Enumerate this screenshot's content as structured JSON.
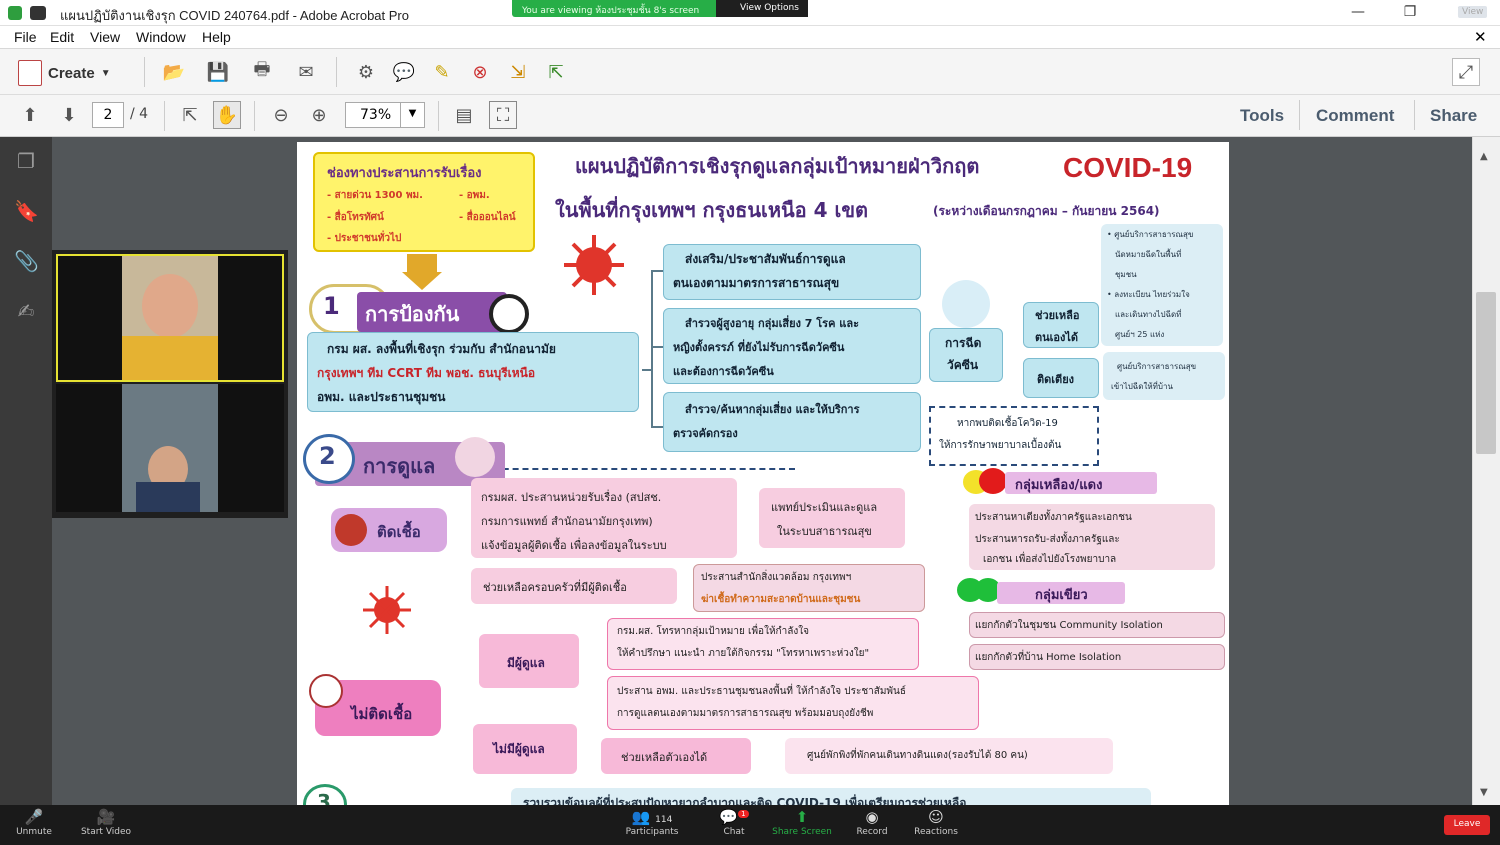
{
  "window": {
    "title": "แผนปฏิบัติงานเชิงรุก COVID 240764.pdf - Adobe Acrobat Pro",
    "view_label": "View"
  },
  "zoom_banner": {
    "text": "You are viewing ห้องประชุมชั้น 8's screen",
    "view_options": "View Options"
  },
  "menu": [
    "File",
    "Edit",
    "View",
    "Window",
    "Help"
  ],
  "toolbar": {
    "create": "Create",
    "page_current": "2",
    "page_total": "/ 4",
    "zoom": "73%",
    "tabs": [
      "Tools",
      "Comment",
      "Share"
    ]
  },
  "doc": {
    "contact_title": "ช่องทางประสานการรับเรื่อง",
    "contact_items": [
      "- สายด่วน 1300 พม.",
      "- อพม.",
      "- สื่อโทรทัศน์",
      "- สื่อออนไลน์",
      "- ประชาชนทั่วไป"
    ],
    "title1": "แผนปฏิบัติการเชิงรุกดูแลกลุ่มเป้าหมายฝ่าวิกฤต",
    "title2": "ในพื้นที่กรุงเทพฯ กรุงธนเหนือ 4 เขต",
    "title2_paren": "(ระหว่างเดือนกรกฎาคม – กันยายน 2564)",
    "logo_text": "COVID-19",
    "s1_num": "1",
    "s1_label": "การป้องกัน",
    "s1_desc": [
      "กรม ผส. ลงพื้นที่เชิงรุก ร่วมกับ สำนักอนามัย",
      "กรุงเทพฯ ทีม CCRT ทีม พอช. ธนบุรีเหนือ",
      "อพม. และประธานชุมชน"
    ],
    "p1": [
      "ส่งเสริม/ประชาสัมพันธ์การดูแล",
      "ตนเองตามมาตรการสาธารณสุข"
    ],
    "p2": [
      "สำรวจผู้สูงอายุ กลุ่มเสี่ยง 7 โรค และ",
      "หญิงตั้งครรภ์ ที่ยังไม่รับการฉีดวัคซีน",
      "และต้องการฉีดวัคซีน"
    ],
    "p3": [
      "สำรวจ/ค้นหากลุ่มเสี่ยง และให้บริการ",
      "ตรวจคัดกรอง"
    ],
    "vaccine": [
      "การฉีด",
      "วัคซีน"
    ],
    "self_help": [
      "ช่วยเหลือ",
      "ตนเองได้"
    ],
    "bedridden": "ติดเตียง",
    "note1": [
      "• ศูนย์บริการสาธารณสุข",
      "นัดหมายฉีดในพื้นที่",
      "ชุมชน",
      "• ลงทะเบียน ไทยร่วมใจ",
      "และเดินทางไปฉีดที่",
      "ศูนย์ฯ 25 แห่ง"
    ],
    "note2": [
      "ศูนย์บริการสาธารณสุข",
      "เข้าไปฉีดให้ที่บ้าน"
    ],
    "if_found": [
      "หากพบติดเชื้อโควิด-19",
      "ให้การรักษาพยาบาลเบื้องต้น"
    ],
    "s2_num": "2",
    "s2_label": "การดูแล",
    "infected": "ติดเชื้อ",
    "c1": [
      "กรมผส. ประสานหน่วยรับเรื่อง (สปสช.",
      "กรมการแพทย์ สำนักอนามัยกรุงเทพ)",
      "แจ้งข้อมูลผู้ติดเชื้อ เพื่อลงข้อมูลในระบบ"
    ],
    "c2": [
      "แพทย์ประเมินและดูแล",
      "ในระบบสาธารณสุข"
    ],
    "c3": "ช่วยเหลือครอบครัวที่มีผู้ติดเชื้อ",
    "c4": [
      "ประสานสำนักสิ่งแวดล้อม กรุงเทพฯ",
      "ฆ่าเชื้อทำความสะอาดบ้านและชุมชน"
    ],
    "yellow_red": "กลุ่มเหลือง/แดง",
    "yr1": "ประสานหาเตียงทั้งภาครัฐและเอกชน",
    "yr2": [
      "ประสานหารถรับ-ส่งทั้งภาครัฐและ",
      "เอกชน เพื่อส่งไปยังโรงพยาบาล"
    ],
    "green": "กลุ่มเขียว",
    "g1": "แยกกักตัวในชุมชน Community Isolation",
    "g2": "แยกกักตัวที่บ้าน Home Isolation",
    "not_infected": "ไม่ติดเชื้อ",
    "has_caregiver": "มีผู้ดูแล",
    "no_caregiver": "ไม่มีผู้ดูแล",
    "n1": [
      "กรม.ผส. โทรหากลุ่มเป้าหมาย เพื่อให้กำลังใจ",
      "ให้คำปรึกษา แนะนำ ภายใต้กิจกรรม \"โทรหาเพราะห่วงใย\""
    ],
    "n2": [
      "ประสาน อพม. และประธานชุมชนลงพื้นที่ ให้กำลังใจ ประชาสัมพันธ์",
      "การดูแลตนเองตามมาตรการสาธารณสุข พร้อมมอบถุงยังชีพ"
    ],
    "n3": "ช่วยเหลือตัวเองได้",
    "n4": "ศูนย์พักพิงที่พักคนเดินทางดินแดง(รองรับได้ 80 คน)",
    "s3_num": "3",
    "s3_desc": "รวบรวมข้อมูลผู้ที่ประสบปัญหายากลำบากและติด COVID-19 เพื่อเตรียมการช่วยเหลือ"
  },
  "zoom_controls": {
    "unmute": "Unmute",
    "start_video": "Start Video",
    "participants": "Participants",
    "participants_count": "114",
    "chat": "Chat",
    "chat_badge": "1",
    "share_screen": "Share Screen",
    "record": "Record",
    "reactions": "Reactions",
    "leave": "Leave"
  },
  "colors": {
    "zoom_green": "#27ae47",
    "purple": "#7a2c86",
    "teal_box": "#bfe6f0",
    "pink_box": "#f7cde0",
    "arrow_pink": "#e64a9a",
    "yellow": "#f9e04b"
  }
}
